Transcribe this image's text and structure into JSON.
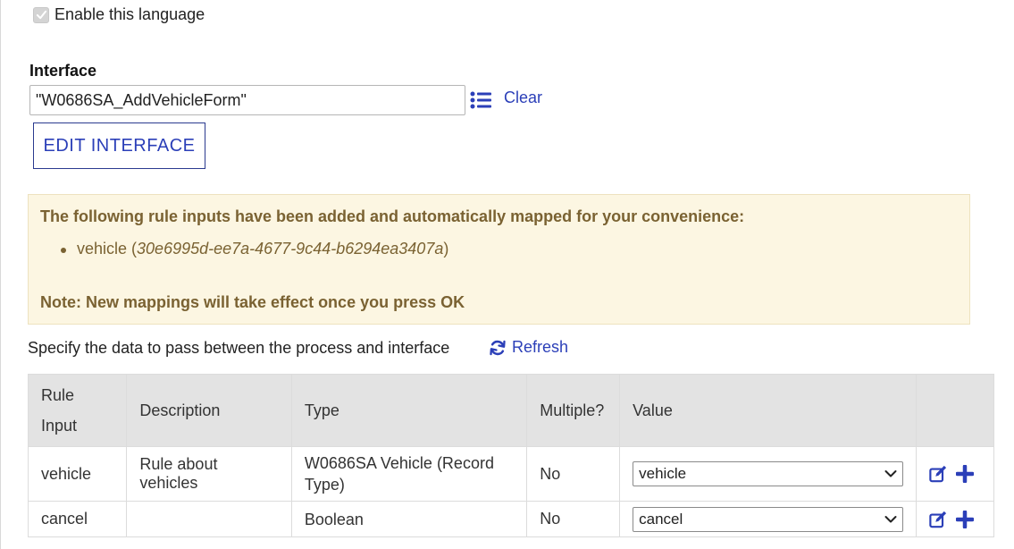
{
  "language": {
    "enable_label": "Enable this language",
    "checked": true
  },
  "interface": {
    "label": "Interface",
    "value": "\"W0686SA_AddVehicleForm\"",
    "clear_label": "Clear",
    "edit_button": "EDIT INTERFACE"
  },
  "notice": {
    "heading": "The following rule inputs have been added and automatically mapped for your convenience:",
    "item_name": "vehicle (",
    "item_id": "30e6995d-ee7a-4677-9c44-b6294ea3407a",
    "item_close": ")",
    "note": "Note: New mappings will take effect once you press OK"
  },
  "mapping": {
    "instruction": "Specify the data to pass between the process and interface",
    "refresh_label": "Refresh",
    "columns": {
      "rule_input_1": "Rule",
      "rule_input_2": "Input",
      "description": "Description",
      "type": "Type",
      "multiple": "Multiple?",
      "value": "Value"
    },
    "rows": [
      {
        "rule_input": "vehicle",
        "description": "Rule about vehicles",
        "type_1": "W0686SA Vehicle (Record",
        "type_2": "Type)",
        "multiple": "No",
        "value": "vehicle"
      },
      {
        "rule_input": "cancel",
        "description": "",
        "type_1": "Boolean",
        "type_2": "",
        "multiple": "No",
        "value": "cancel"
      }
    ]
  },
  "colors": {
    "link": "#2b3fb8",
    "notice_bg": "#fcf6e2",
    "notice_text": "#7a6232",
    "header_bg": "#e3e3e3"
  }
}
